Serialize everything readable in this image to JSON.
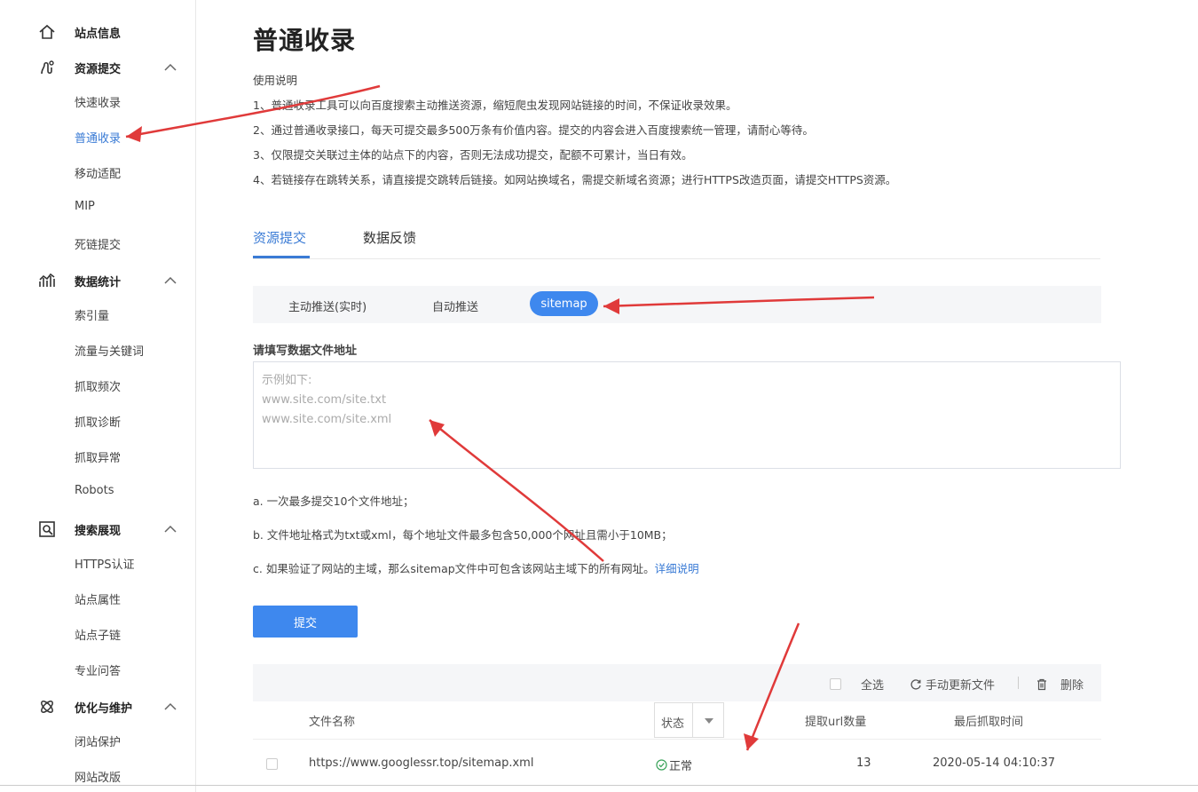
{
  "sidebar": {
    "sections": [
      {
        "label": "站点信息",
        "icon": "home-icon"
      },
      {
        "label": "资源提交",
        "icon": "resource-submit-icon",
        "items": [
          "快速收录",
          "普通收录",
          "移动适配",
          "MIP",
          "死链提交"
        ]
      },
      {
        "label": "数据统计",
        "icon": "stats-icon",
        "items": [
          "索引量",
          "流量与关键词",
          "抓取频次",
          "抓取诊断",
          "抓取异常",
          "Robots"
        ]
      },
      {
        "label": "搜索展现",
        "icon": "search-display-icon",
        "items": [
          "HTTPS认证",
          "站点属性",
          "站点子链",
          "专业问答"
        ]
      },
      {
        "label": "优化与维护",
        "icon": "optimize-icon",
        "items": [
          "闭站保护",
          "网站改版"
        ]
      }
    ]
  },
  "main": {
    "title": "普通收录",
    "usage_title": "使用说明",
    "usage_lines": [
      "1、普通收录工具可以向百度搜索主动推送资源，缩短爬虫发现网站链接的时间，不保证收录效果。",
      "2、通过普通收录接口，每天可提交最多500万条有价值内容。提交的内容会进入百度搜索统一管理，请耐心等待。",
      "3、仅限提交关联过主体的站点下的内容，否则无法成功提交，配额不可累计，当日有效。",
      "4、若链接存在跳转关系，请直接提交跳转后链接。如网站换域名，需提交新域名资源；进行HTTPS改造页面，请提交HTTPS资源。"
    ],
    "tabs": [
      "资源提交",
      "数据反馈"
    ],
    "subtabs": [
      "主动推送(实时)",
      "自动推送",
      "sitemap"
    ],
    "field_label": "请填写数据文件地址",
    "textarea_placeholder": "示例如下:\nwww.site.com/site.txt\nwww.site.com/site.xml",
    "notes": {
      "a": "a. 一次最多提交10个文件地址；",
      "b": "b. 文件地址格式为txt或xml，每个地址文件最多包含50,000个网址且需小于10MB；",
      "c": "c. 如果验证了网站的主域，那么sitemap文件中可包含该网站主域下的所有网址。",
      "c_link": "详细说明"
    },
    "submit_label": "提交",
    "table": {
      "select_all": "全选",
      "manual_update": "手动更新文件",
      "delete": "删除",
      "headers": {
        "file": "文件名称",
        "status": "状态",
        "url_count": "提取url数量",
        "last_time": "最后抓取时间"
      },
      "rows": [
        {
          "file": "https://www.googlessr.top/sitemap.xml",
          "status": "正常",
          "url_count": "13",
          "last_time": "2020-05-14 04:10:37"
        }
      ]
    }
  },
  "colors": {
    "accent": "#3e88ee",
    "link": "#3a7bd5",
    "arrow": "#e03a3a"
  }
}
